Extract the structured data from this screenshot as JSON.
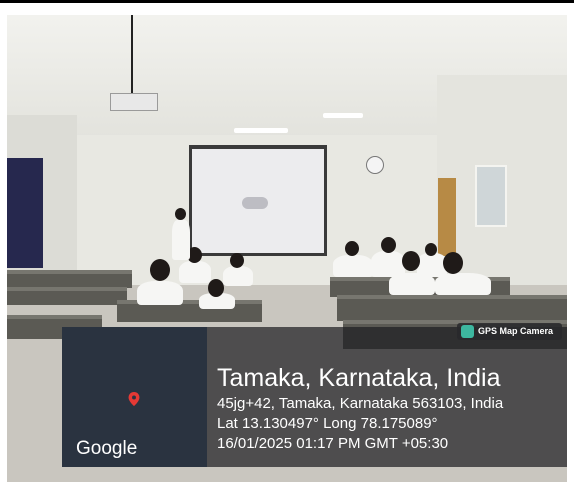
{
  "location": {
    "title": "Tamaka, Karnataka, India",
    "address": "45jg+42, Tamaka, Karnataka 563103, India",
    "coordinates": "Lat 13.130497° Long 78.175089°",
    "datetime": "16/01/2025 01:17 PM GMT +05:30"
  },
  "badge": {
    "label": "GPS Map Camera",
    "icon": "gps-map-camera-icon"
  },
  "map": {
    "logo": "Google",
    "pin_color": "#e53935"
  }
}
